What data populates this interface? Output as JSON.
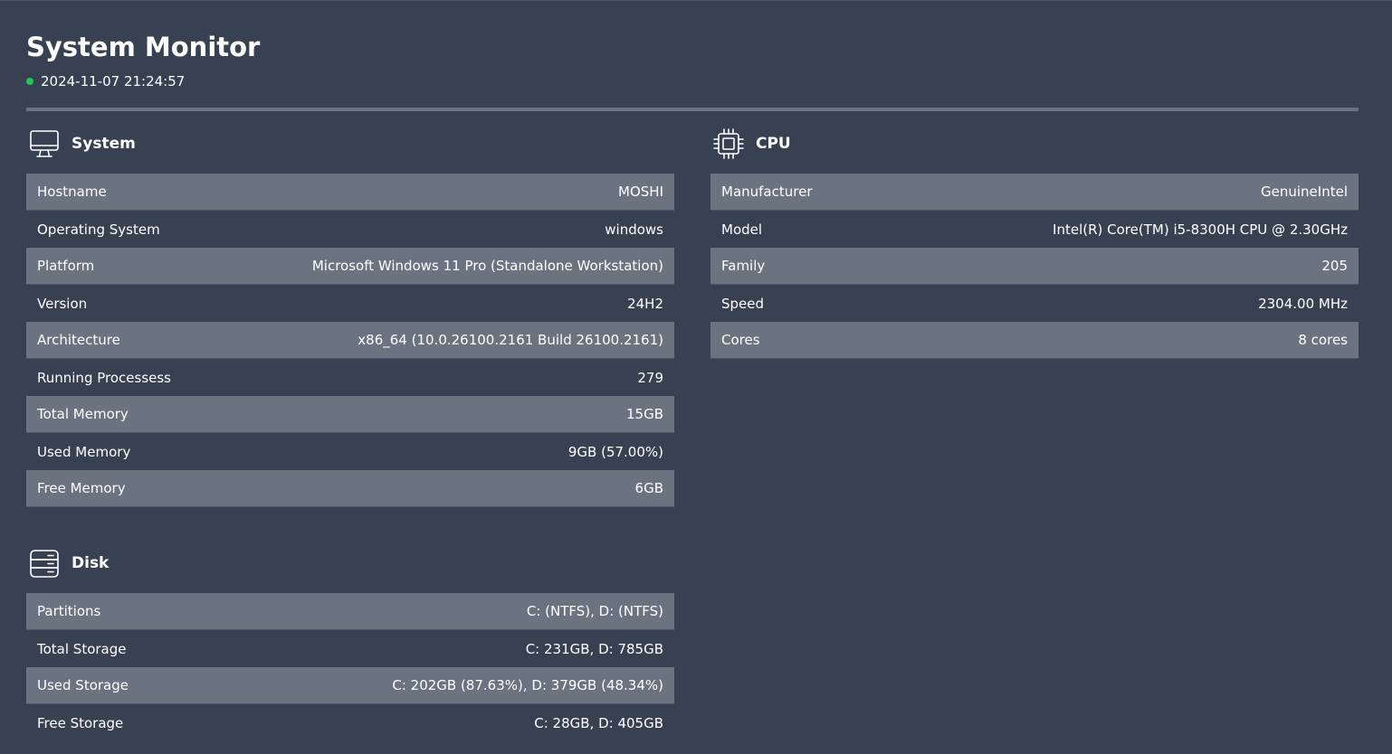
{
  "app": {
    "title": "System Monitor",
    "timestamp": "2024-11-07 21:24:57",
    "status_color": "#22c55e"
  },
  "colors": {
    "background": "#374151",
    "row_alt": "#6b7280",
    "text": "#ffffff"
  },
  "system": {
    "title": "System",
    "icon": "monitor-icon",
    "rows": [
      {
        "label": "Hostname",
        "value": "MOSHI"
      },
      {
        "label": "Operating System",
        "value": "windows"
      },
      {
        "label": "Platform",
        "value": "Microsoft Windows 11 Pro (Standalone Workstation)"
      },
      {
        "label": "Version",
        "value": "24H2"
      },
      {
        "label": "Architecture",
        "value": "x86_64 (10.0.26100.2161 Build 26100.2161)"
      },
      {
        "label": "Running Processess",
        "value": "279"
      },
      {
        "label": "Total Memory",
        "value": "15GB"
      },
      {
        "label": "Used Memory",
        "value": "9GB (57.00%)"
      },
      {
        "label": "Free Memory",
        "value": "6GB"
      }
    ]
  },
  "cpu": {
    "title": "CPU",
    "icon": "cpu-icon",
    "rows": [
      {
        "label": "Manufacturer",
        "value": "GenuineIntel"
      },
      {
        "label": "Model",
        "value": "Intel(R) Core(TM) i5-8300H CPU @ 2.30GHz"
      },
      {
        "label": "Family",
        "value": "205"
      },
      {
        "label": "Speed",
        "value": "2304.00 MHz"
      },
      {
        "label": "Cores",
        "value": "8 cores"
      }
    ]
  },
  "disk": {
    "title": "Disk",
    "icon": "storage-icon",
    "rows": [
      {
        "label": "Partitions",
        "value": "C: (NTFS), D: (NTFS)"
      },
      {
        "label": "Total Storage",
        "value": "C: 231GB, D: 785GB"
      },
      {
        "label": "Used Storage",
        "value": "C: 202GB (87.63%), D: 379GB (48.34%)"
      },
      {
        "label": "Free Storage",
        "value": "C: 28GB, D: 405GB"
      }
    ]
  }
}
